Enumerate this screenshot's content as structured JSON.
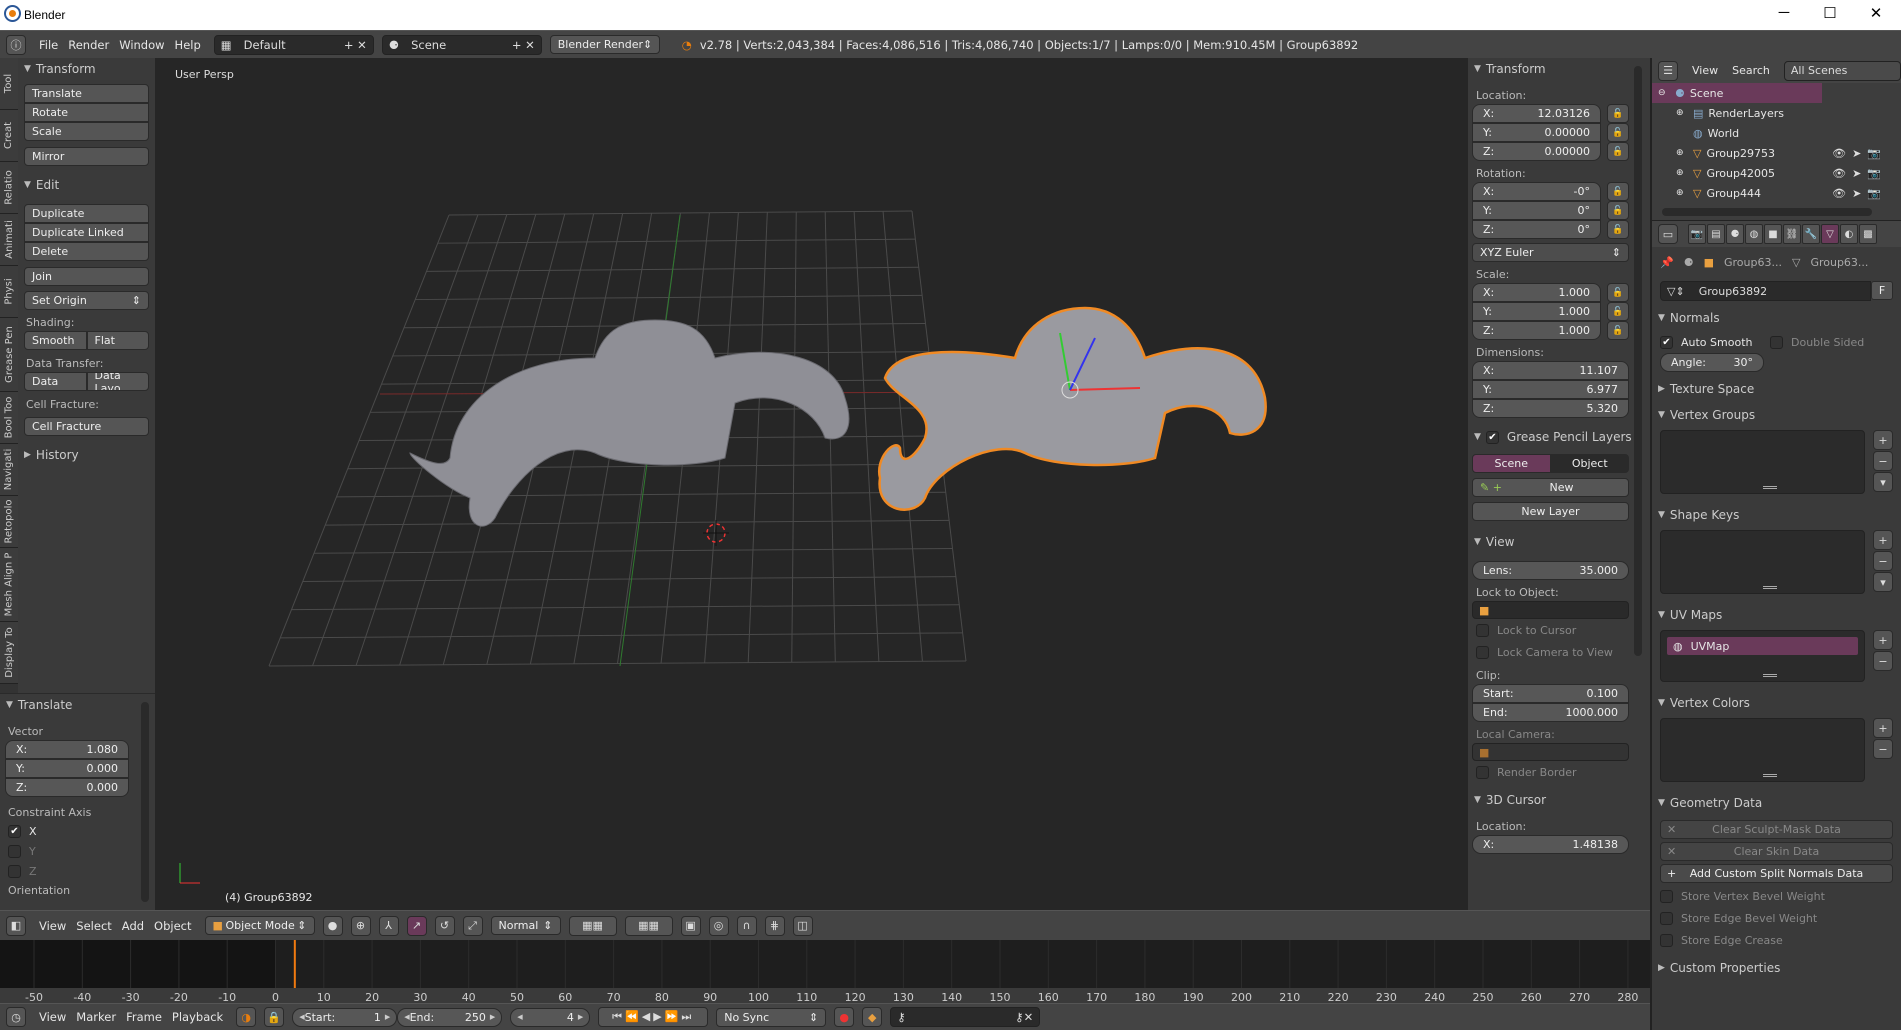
{
  "window": {
    "title": "Blender",
    "min": "─",
    "max": "☐",
    "close": "✕"
  },
  "topbar": {
    "menus": [
      "File",
      "Render",
      "Window",
      "Help"
    ],
    "layout": "Default",
    "scene": "Scene",
    "engine": "Blender Render",
    "stats": "v2.78 | Verts:2,043,384 | Faces:4,086,516 | Tris:4,086,740 | Objects:1/7 | Lamps:0/0 | Mem:910.45M | Group63892"
  },
  "tooltabs": [
    "Tool",
    "Creat",
    "Relatio",
    "Animati",
    "Physi",
    "Grease Pen",
    "Bool Too",
    "Navigati",
    "Retopolo",
    "Mesh Align P",
    "Display To"
  ],
  "toolshelf": {
    "transform_title": "Transform",
    "transform_buttons": [
      "Translate",
      "Rotate",
      "Scale"
    ],
    "mirror": "Mirror",
    "edit_title": "Edit",
    "edit_buttons": [
      "Duplicate",
      "Duplicate Linked",
      "Delete"
    ],
    "join": "Join",
    "set_origin": "Set Origin",
    "shading_label": "Shading:",
    "smooth": "Smooth",
    "flat": "Flat",
    "data_transfer_label": "Data Transfer:",
    "data": "Data",
    "data_layout": "Data Layo",
    "cell_fracture_label": "Cell Fracture:",
    "cell_fracture": "Cell Fracture",
    "history": "History"
  },
  "operator": {
    "title": "Translate",
    "vector_label": "Vector",
    "vector": [
      {
        "k": "X:",
        "v": "1.080"
      },
      {
        "k": "Y:",
        "v": "0.000"
      },
      {
        "k": "Z:",
        "v": "0.000"
      }
    ],
    "constraint_label": "Constraint Axis",
    "axes": [
      {
        "k": "X",
        "checked": true
      },
      {
        "k": "Y",
        "checked": false
      },
      {
        "k": "Z",
        "checked": false
      }
    ],
    "orientation_label": "Orientation"
  },
  "viewport": {
    "view_name": "User Persp",
    "object_label": "(4) Group63892",
    "selected_outline": "#f08a24"
  },
  "npanel": {
    "transform_title": "Transform",
    "location_label": "Location:",
    "location": [
      {
        "k": "X:",
        "v": "12.03126"
      },
      {
        "k": "Y:",
        "v": "0.00000"
      },
      {
        "k": "Z:",
        "v": "0.00000"
      }
    ],
    "rotation_label": "Rotation:",
    "rotation": [
      {
        "k": "X:",
        "v": "-0°"
      },
      {
        "k": "Y:",
        "v": "0°"
      },
      {
        "k": "Z:",
        "v": "0°"
      }
    ],
    "rotation_mode": "XYZ Euler",
    "scale_label": "Scale:",
    "scale": [
      {
        "k": "X:",
        "v": "1.000"
      },
      {
        "k": "Y:",
        "v": "1.000"
      },
      {
        "k": "Z:",
        "v": "1.000"
      }
    ],
    "dimensions_label": "Dimensions:",
    "dimensions": [
      {
        "k": "X:",
        "v": "11.107"
      },
      {
        "k": "Y:",
        "v": "6.977"
      },
      {
        "k": "Z:",
        "v": "5.320"
      }
    ],
    "gp_title": "Grease Pencil Layers",
    "gp_scene": "Scene",
    "gp_object": "Object",
    "gp_new": "New",
    "gp_new_layer": "New Layer",
    "view_title": "View",
    "lens": {
      "k": "Lens:",
      "v": "35.000"
    },
    "lock_to_object": "Lock to Object:",
    "lock_to_cursor": "Lock to Cursor",
    "lock_camera": "Lock Camera to View",
    "clip_label": "Clip:",
    "clip": [
      {
        "k": "Start:",
        "v": "0.100"
      },
      {
        "k": "End:",
        "v": "1000.000"
      }
    ],
    "local_camera": "Local Camera:",
    "render_border": "Render Border",
    "cursor_title": "3D Cursor",
    "cursor_location_label": "Location:",
    "cursor_x": {
      "k": "X:",
      "v": "1.48138"
    }
  },
  "outliner": {
    "view": "View",
    "search": "Search",
    "filter": "All Scenes",
    "items": [
      {
        "name": "Scene",
        "depth": 0,
        "type": "scene"
      },
      {
        "name": "RenderLayers",
        "depth": 1,
        "type": "renderlayers"
      },
      {
        "name": "World",
        "depth": 1,
        "type": "world"
      },
      {
        "name": "Group29753",
        "depth": 1,
        "type": "mesh"
      },
      {
        "name": "Group42005",
        "depth": 1,
        "type": "mesh"
      },
      {
        "name": "Group444",
        "depth": 1,
        "type": "mesh"
      }
    ]
  },
  "properties": {
    "crumbs": [
      "Group63...",
      "Group63..."
    ],
    "mesh_name": "Group63892",
    "fake_user": "F",
    "normals_title": "Normals",
    "auto_smooth": "Auto Smooth",
    "double_sided": "Double Sided",
    "angle": {
      "k": "Angle:",
      "v": "30°"
    },
    "texture_space": "Texture Space",
    "vertex_groups": "Vertex Groups",
    "shape_keys": "Shape Keys",
    "uv_maps": "UV Maps",
    "uv_map_item": "UVMap",
    "vertex_colors": "Vertex Colors",
    "geometry_data": "Geometry Data",
    "clear_sculpt": "Clear Sculpt-Mask Data",
    "clear_skin": "Clear Skin Data",
    "add_split": "Add Custom Split Normals Data",
    "store_options": [
      "Store Vertex Bevel Weight",
      "Store Edge Bevel Weight",
      "Store Edge Crease"
    ],
    "custom_properties": "Custom Properties",
    "accent": "#6a3a5a"
  },
  "view3d_header": {
    "menus": [
      "View",
      "Select",
      "Add",
      "Object"
    ],
    "mode": "Object Mode",
    "orientation": "Normal"
  },
  "timeline": {
    "ticks": [
      -50,
      -40,
      -30,
      -20,
      -10,
      0,
      10,
      20,
      30,
      40,
      50,
      60,
      70,
      80,
      90,
      100,
      110,
      120,
      130,
      140,
      150,
      160,
      170,
      180,
      190,
      200,
      210,
      220,
      230,
      240,
      250,
      260,
      270,
      280
    ],
    "current_frame": 4,
    "menus": [
      "View",
      "Marker",
      "Frame",
      "Playback"
    ],
    "start": {
      "k": "Start:",
      "v": "1"
    },
    "end": {
      "k": "End:",
      "v": "250"
    },
    "frame": "4",
    "sync": "No Sync"
  }
}
